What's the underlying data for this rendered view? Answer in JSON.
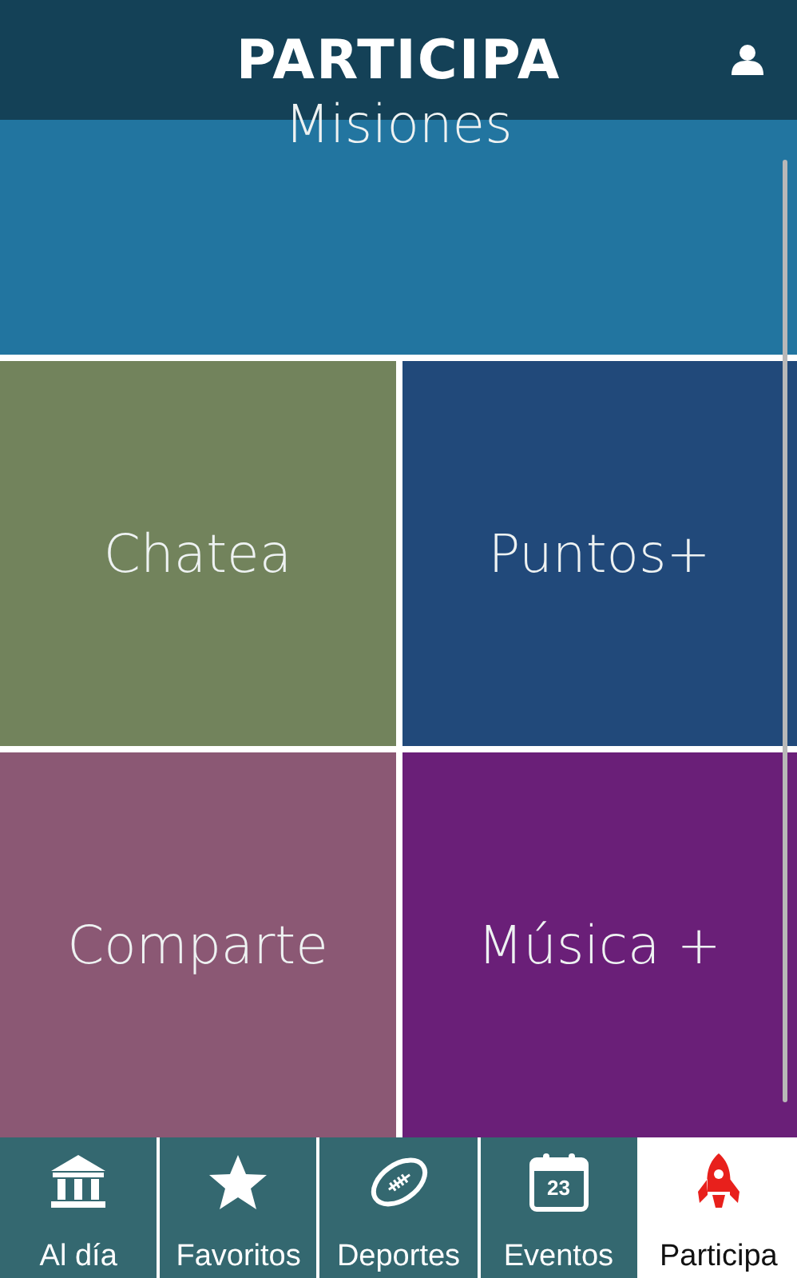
{
  "header": {
    "title": "PARTICIPA"
  },
  "tiles": [
    {
      "label": "Misiones",
      "color": "#2275a0",
      "wide": true
    },
    {
      "label": "Chatea",
      "color": "#72835c",
      "wide": false
    },
    {
      "label": "Puntos+",
      "color": "#21497a",
      "wide": false
    },
    {
      "label": "Comparte",
      "color": "#8b5874",
      "wide": false
    },
    {
      "label": "Música +",
      "color": "#6a1f78",
      "wide": false
    }
  ],
  "nav": [
    {
      "label": "Al día",
      "kind": "bank",
      "selected": false
    },
    {
      "label": "Favoritos",
      "kind": "star",
      "selected": false
    },
    {
      "label": "Deportes",
      "kind": "ball",
      "selected": false
    },
    {
      "label": "Eventos",
      "kind": "calendar",
      "icon_text": "23",
      "selected": false
    },
    {
      "label": "Participa",
      "kind": "rocket",
      "selected": true
    }
  ]
}
